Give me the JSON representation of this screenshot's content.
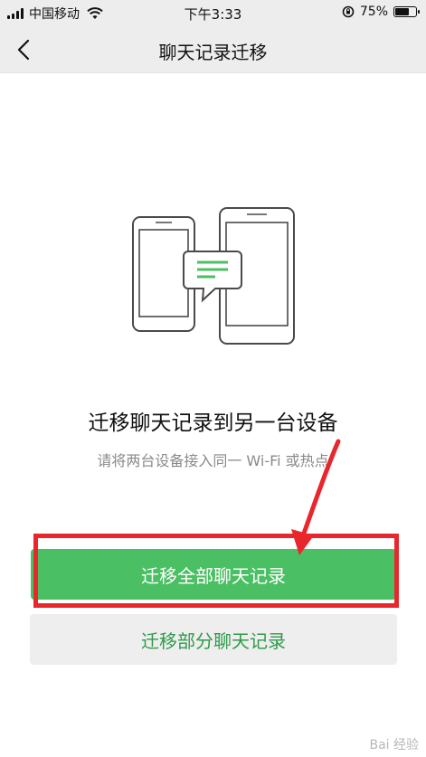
{
  "status_bar": {
    "carrier": "中国移动",
    "time": "下午3:33",
    "battery_percent": "75%",
    "battery_level": 0.75,
    "icons": [
      "signal-icon",
      "wifi-icon",
      "orientation-lock-icon",
      "battery-icon"
    ]
  },
  "nav": {
    "title": "聊天记录迁移",
    "back_icon": "chevron-left-icon"
  },
  "content": {
    "illustration_icon": "phone-to-tablet-transfer-icon",
    "headline": "迁移聊天记录到另一台设备",
    "subline": "请将两台设备接入同一 Wi-Fi 或热点"
  },
  "buttons": {
    "migrate_all": "迁移全部聊天记录",
    "migrate_part": "迁移部分聊天记录"
  },
  "annotation": {
    "highlight_color": "#e8262c"
  },
  "colors": {
    "accent": "#4bbf63",
    "accent_text": "#2e9a4a",
    "bar_bg": "#ededed"
  },
  "watermark": "Bai 经验"
}
